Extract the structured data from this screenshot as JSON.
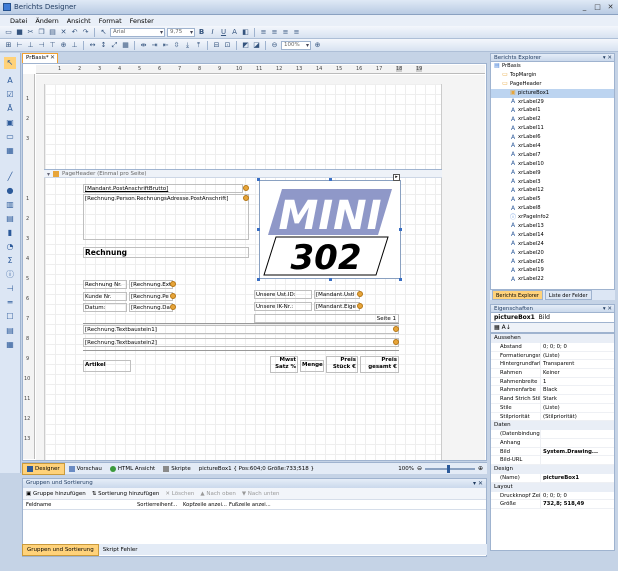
{
  "window": {
    "title": "Berichts Designer",
    "buttons": [
      "_",
      "□",
      "✕"
    ]
  },
  "menu": [
    "Datei",
    "Ändern",
    "Ansicht",
    "Format",
    "Fenster"
  ],
  "toolbar": {
    "font": "Arial",
    "size": "9,75",
    "zoom": "100%"
  },
  "document_tab": "PrBasis*",
  "ruler": {
    "h": [
      "1",
      "2",
      "3",
      "4",
      "5",
      "6",
      "7",
      "8",
      "9",
      "10",
      "11",
      "12",
      "13",
      "14",
      "15",
      "16",
      "17",
      "18",
      "19"
    ],
    "v": [
      "1",
      "2",
      "3",
      "4",
      "5",
      "6",
      "7",
      "8",
      "9",
      "10",
      "11",
      "12",
      "13",
      "14",
      "15",
      "16",
      "17",
      "18"
    ]
  },
  "band": {
    "page_header": "PageHeader (Einmal pro Seite)"
  },
  "report": {
    "addr1": "[Mandant.PostAnschriftBrutto]",
    "addr2": "[Rechnung.Person.RechnungsAdresse.PostAnschrift]",
    "rechnung": "Rechnung",
    "label_nr": "Rechnung Nr.",
    "val_nr": "[Rechnung.Ext",
    "label_kunde": "Kunde Nr.",
    "val_kunde": "[Rechnung.Pe",
    "label_datum": "Datum:",
    "val_datum": "[Rechnung.Da",
    "label_ust": "Unsere Ust.ID:",
    "val_ust": "[Mandant.Ustl",
    "label_ik": "Unsere IK-Nr.:",
    "val_ik": "[Mandant.Eige",
    "seite": "Seite 1",
    "text1": "[Rechnung.Textbaustein1]",
    "text2": "[Rechnung.Textbaustein2]",
    "col_artikel": "Artikel",
    "col_mwst": "Mwst Satz %",
    "col_menge": "Menge",
    "col_preis": "Preis Stück €",
    "col_gesamt": "Preis gesamt €",
    "logo_top": "MINI",
    "logo_bottom": "302"
  },
  "editor_tabs": {
    "designer": "Designer",
    "vorschau": "Vorschau",
    "html": "HTML Ansicht",
    "skripte": "Skripte",
    "status": "pictureBox1 { Pos:604;0 Größe:733;518 }",
    "zoom": "100%"
  },
  "bottom": {
    "title": "Gruppen und Sortierung",
    "buttons": [
      "Gruppe hinzufügen",
      "Sortierung hinzufügen",
      "Löschen",
      "Nach oben",
      "Nach unten"
    ],
    "columns": [
      "Feldname",
      "Sortierreihenf...",
      "Kopfzeile anzei...",
      "Fußzeile anzei..."
    ],
    "tabs": [
      "Gruppen und Sortierung",
      "Skript Fehler"
    ]
  },
  "explorer": {
    "title": "Berichts Explorer",
    "nodes": [
      {
        "label": "PrBasis",
        "level": 0,
        "icon": "report"
      },
      {
        "label": "TopMargin",
        "level": 1,
        "icon": "band"
      },
      {
        "label": "PageHeader",
        "level": 1,
        "icon": "band"
      },
      {
        "label": "pictureBox1",
        "level": 2,
        "icon": "picture",
        "selected": true
      },
      {
        "label": "xrLabel29",
        "level": 2,
        "icon": "label"
      },
      {
        "label": "xrLabel1",
        "level": 2,
        "icon": "label"
      },
      {
        "label": "xrLabel2",
        "level": 2,
        "icon": "label"
      },
      {
        "label": "xrLabel11",
        "level": 2,
        "icon": "label"
      },
      {
        "label": "xrLabel6",
        "level": 2,
        "icon": "label"
      },
      {
        "label": "xrLabel4",
        "level": 2,
        "icon": "label"
      },
      {
        "label": "xrLabel7",
        "level": 2,
        "icon": "label"
      },
      {
        "label": "xrLabel10",
        "level": 2,
        "icon": "label"
      },
      {
        "label": "xrLabel9",
        "level": 2,
        "icon": "label"
      },
      {
        "label": "xrLabel3",
        "level": 2,
        "icon": "label"
      },
      {
        "label": "xrLabel12",
        "level": 2,
        "icon": "label"
      },
      {
        "label": "xrLabel5",
        "level": 2,
        "icon": "label"
      },
      {
        "label": "xrLabel8",
        "level": 2,
        "icon": "label"
      },
      {
        "label": "xrPageInfo2",
        "level": 2,
        "icon": "pageinfo"
      },
      {
        "label": "xrLabel13",
        "level": 2,
        "icon": "label"
      },
      {
        "label": "xrLabel14",
        "level": 2,
        "icon": "label"
      },
      {
        "label": "xrLabel24",
        "level": 2,
        "icon": "label"
      },
      {
        "label": "xrLabel20",
        "level": 2,
        "icon": "label"
      },
      {
        "label": "xrLabel26",
        "level": 2,
        "icon": "label"
      },
      {
        "label": "xrLabel19",
        "level": 2,
        "icon": "label"
      },
      {
        "label": "xrLabel22",
        "level": 2,
        "icon": "label"
      }
    ],
    "tabs": [
      "Berichts Explorer",
      "Liste der Felder"
    ]
  },
  "properties": {
    "title": "Eigenschaften",
    "object": "pictureBox1",
    "object_type": "Bild",
    "groups": [
      {
        "name": "Aussehen",
        "rows": [
          [
            "Abstand",
            "0; 0; 0; 0"
          ],
          [
            "Formatierungsreg",
            "(Liste)"
          ],
          [
            "Hintergrundfarbe",
            "Transparent"
          ],
          [
            "Rahmen",
            "Keiner"
          ],
          [
            "Rahmenbreite",
            "1"
          ],
          [
            "Rahmenfarbe",
            "Black"
          ],
          [
            "Rand Strich Stil",
            "Stark"
          ],
          [
            "Stile",
            "(Liste)"
          ],
          [
            "Stilpriorität",
            "(Stilpriorität)"
          ]
        ]
      },
      {
        "name": "Daten",
        "rows": [
          [
            "(Datenbindung)",
            ""
          ],
          [
            "Anhang",
            ""
          ],
          [
            "Bild",
            "System.Drawing..."
          ],
          [
            "Bild-URL",
            ""
          ]
        ]
      },
      {
        "name": "Design",
        "rows": [
          [
            "(Name)",
            "pictureBox1"
          ]
        ]
      },
      {
        "name": "Layout",
        "rows": [
          [
            "Druckknopf Zeilen",
            "0; 0; 0; 0"
          ],
          [
            "Größe",
            "732,8; 518,49"
          ]
        ]
      }
    ]
  }
}
